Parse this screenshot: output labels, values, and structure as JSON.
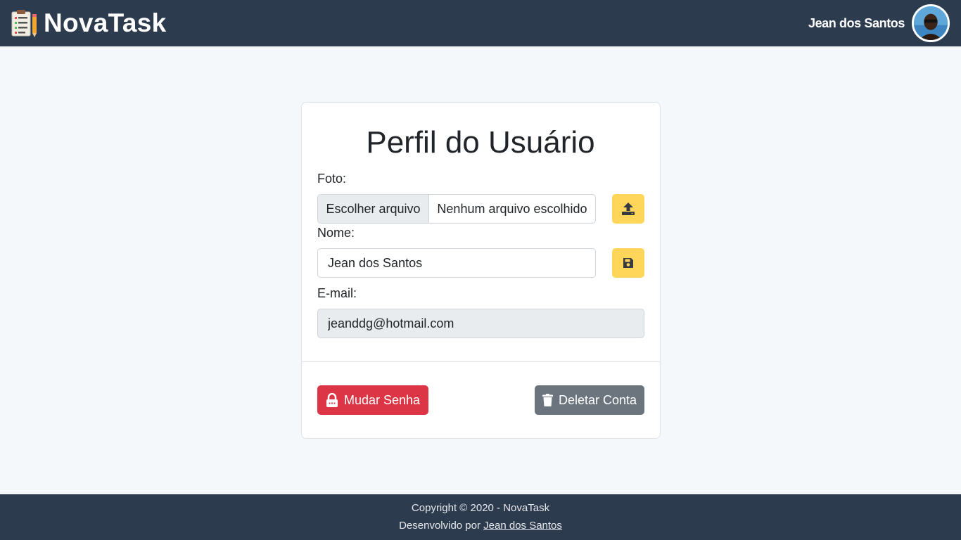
{
  "header": {
    "brand_icon": "clipboard-pencil-icon",
    "brand_name": "NovaTask",
    "user_name": "Jean dos Santos",
    "colors": {
      "background": "#2d3b4e"
    }
  },
  "profile": {
    "title": "Perfil do Usuário",
    "photo_label": "Foto:",
    "file_button_label": "Escolher arquivo",
    "file_status": "Nenhum arquivo escolhido",
    "upload_icon": "upload-icon",
    "name_label": "Nome:",
    "name_value": "Jean dos Santos",
    "save_icon": "floppy-disk-icon",
    "email_label": "E-mail:",
    "email_value": "jeanddg@hotmail.com",
    "change_password_label": "Mudar Senha",
    "change_password_icon": "lock-icon",
    "delete_account_label": "Deletar Conta",
    "delete_account_icon": "trash-icon",
    "colors": {
      "warning": "#ffd65a",
      "danger": "#dc3545",
      "secondary": "#6c757d"
    }
  },
  "footer": {
    "copyright": "Copyright © 2020 - NovaTask",
    "developed_by": "Desenvolvido por",
    "author_link": "Jean dos Santos"
  }
}
